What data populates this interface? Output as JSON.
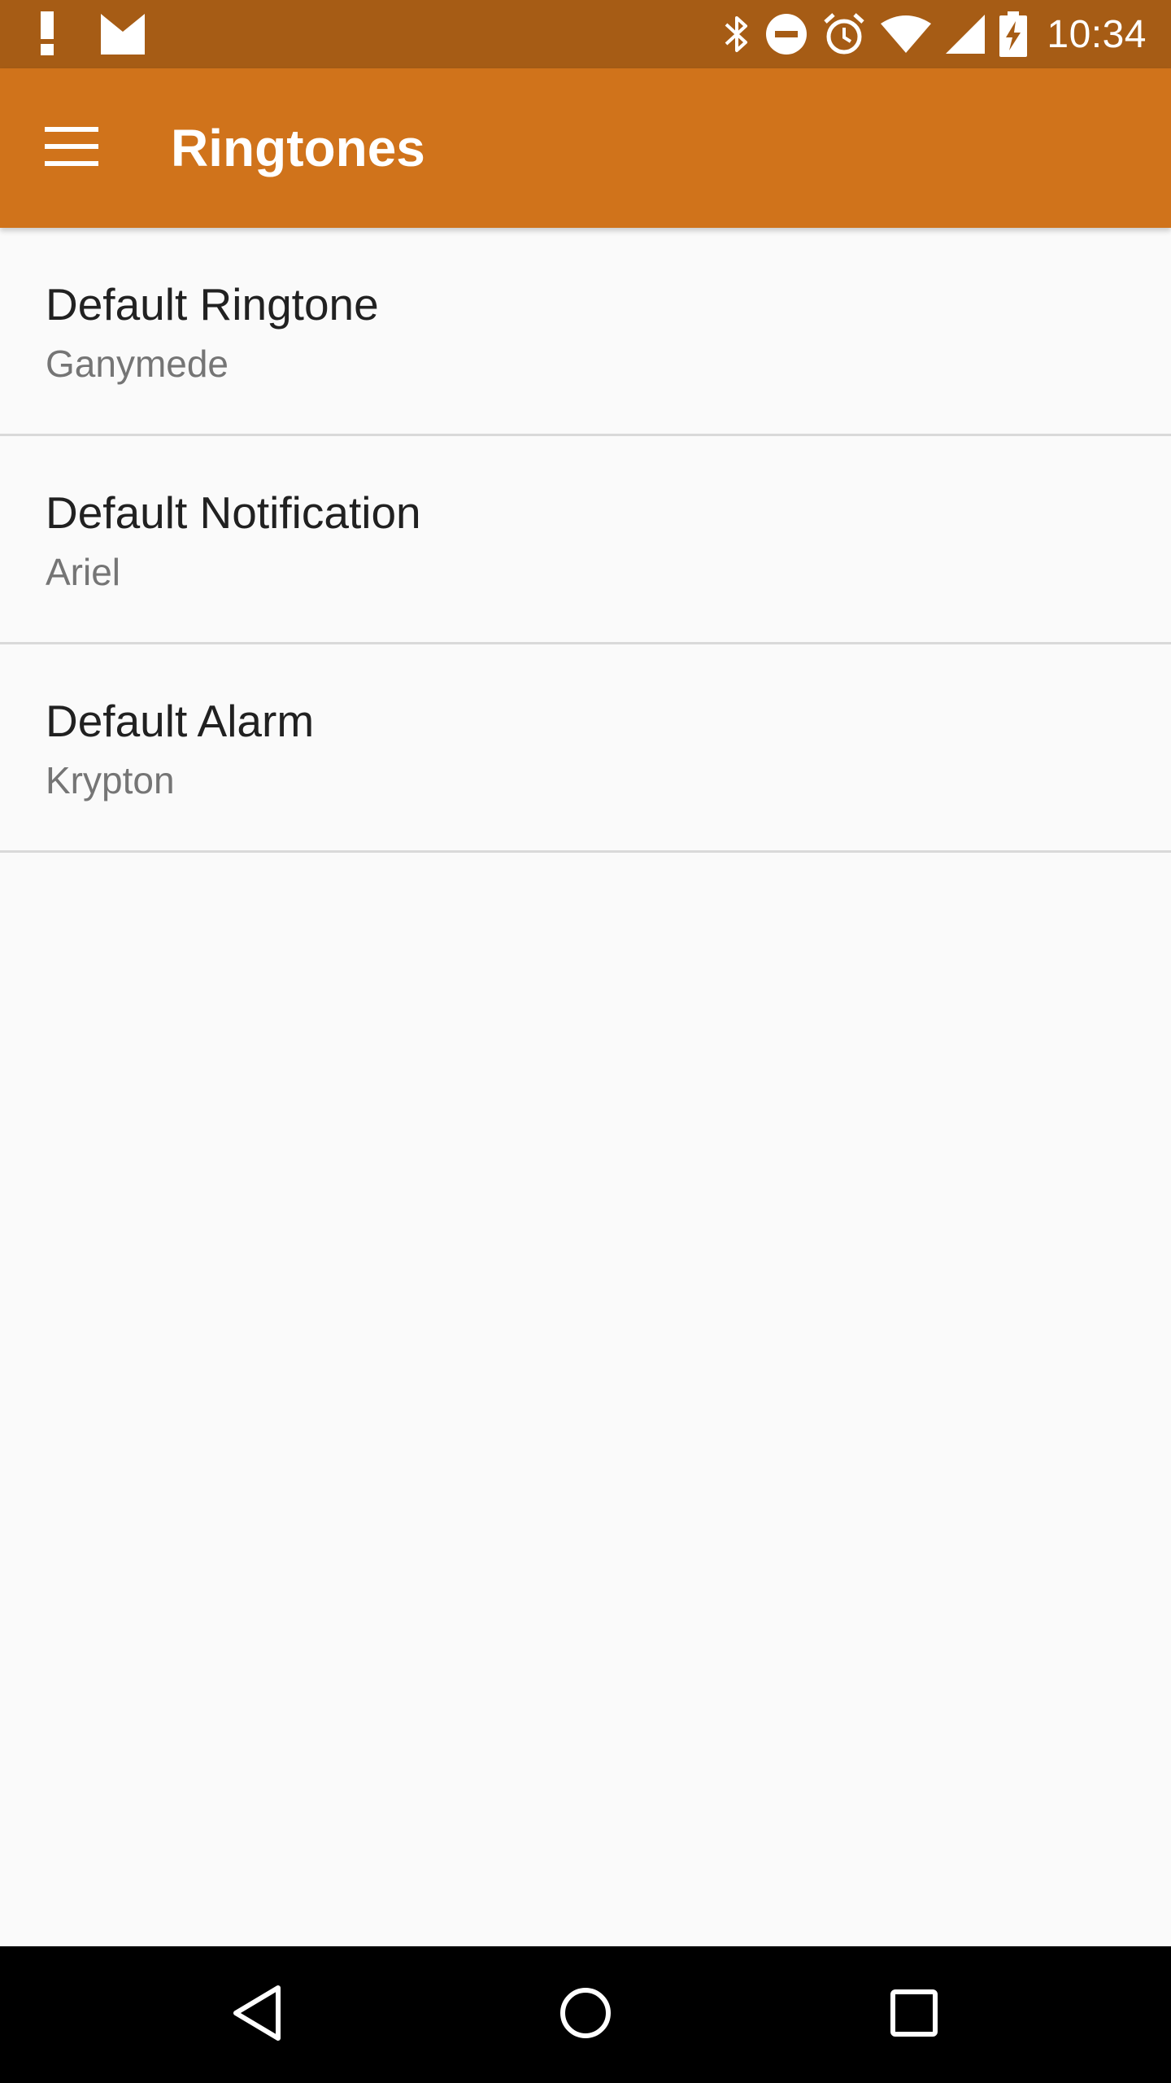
{
  "status_bar": {
    "time": "10:34",
    "left_icons": [
      "alert-icon",
      "gmail-icon"
    ],
    "right_icons": [
      "bluetooth-icon",
      "do-not-disturb-icon",
      "alarm-icon",
      "wifi-icon",
      "cell-signal-icon",
      "battery-charging-icon"
    ],
    "background": "#a65c15"
  },
  "app_bar": {
    "title": "Ringtones",
    "menu_icon": "hamburger-menu-icon",
    "background": "#d0731b"
  },
  "preferences": [
    {
      "title": "Default Ringtone",
      "summary": "Ganymede"
    },
    {
      "title": "Default Notification",
      "summary": "Ariel"
    },
    {
      "title": "Default Alarm",
      "summary": "Krypton"
    }
  ],
  "nav_bar": {
    "buttons": [
      "back-icon",
      "home-icon",
      "recents-icon"
    ]
  }
}
